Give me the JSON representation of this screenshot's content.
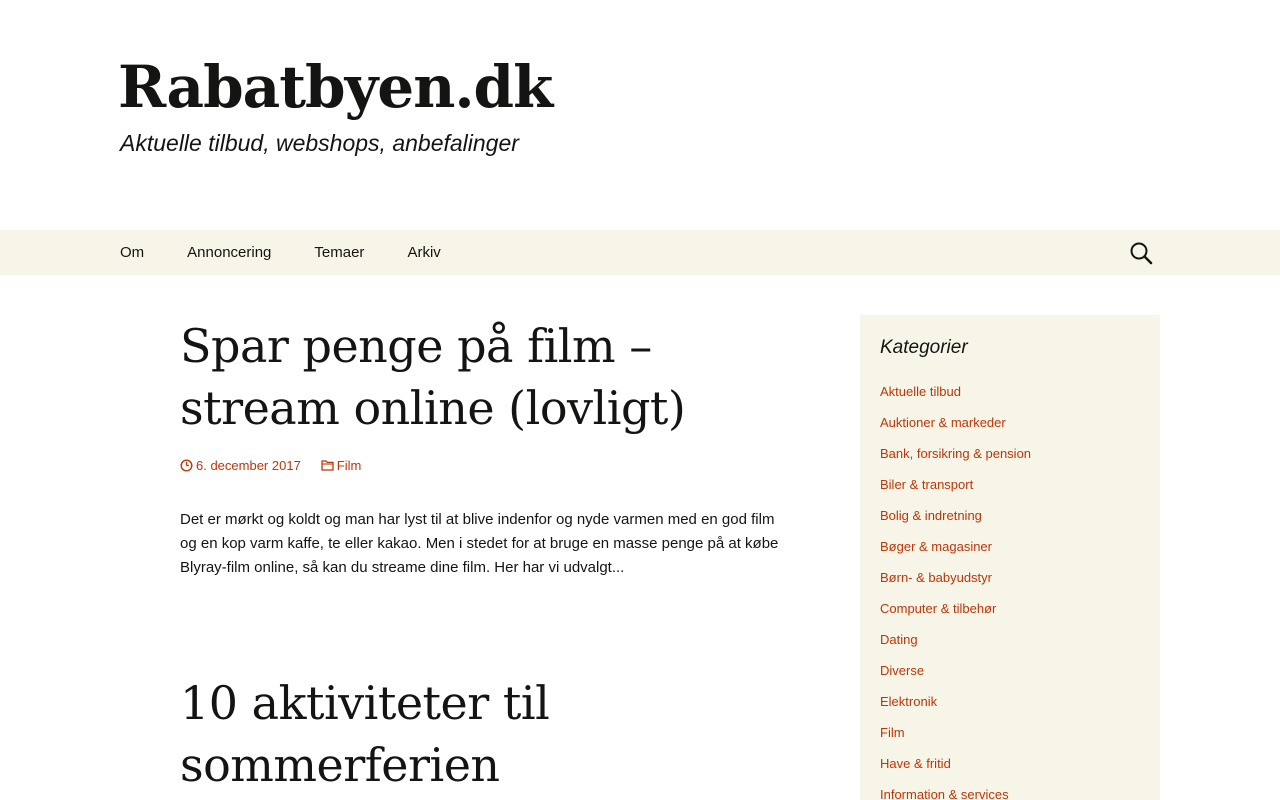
{
  "header": {
    "site_title": "Rabatbyen.dk",
    "site_description": "Aktuelle tilbud, webshops, anbefalinger"
  },
  "nav": {
    "items": [
      "Om",
      "Annoncering",
      "Temaer",
      "Arkiv"
    ],
    "search_icon": "search-icon"
  },
  "posts": [
    {
      "title_line1": "Spar penge på film –",
      "title_line2": "stream online (lovligt)",
      "date": "6. december 2017",
      "category": "Film",
      "summary": "Det er mørkt og koldt og man har lyst til at blive indenfor og nyde varmen med en god film og en kop varm kaffe, te eller kakao. Men i stedet for at bruge en masse penge på at købe Blyray-film online, så kan du streame dine film. Her har vi udvalgt..."
    },
    {
      "title_line1": "10 aktiviteter til",
      "title_line2": "sommerferien"
    }
  ],
  "sidebar": {
    "widget_title": "Kategorier",
    "categories": [
      "Aktuelle tilbud",
      "Auktioner & markeder",
      "Bank, forsikring & pension",
      "Biler & transport",
      "Bolig & indretning",
      "Bøger & magasiner",
      "Børn- & babyudstyr",
      "Computer & tilbehør",
      "Dating",
      "Diverse",
      "Elektronik",
      "Film",
      "Have & fritid",
      "Information & services"
    ]
  },
  "colors": {
    "accent": "#bc360a",
    "nav_background": "#f7f5e7",
    "text": "#141412"
  }
}
